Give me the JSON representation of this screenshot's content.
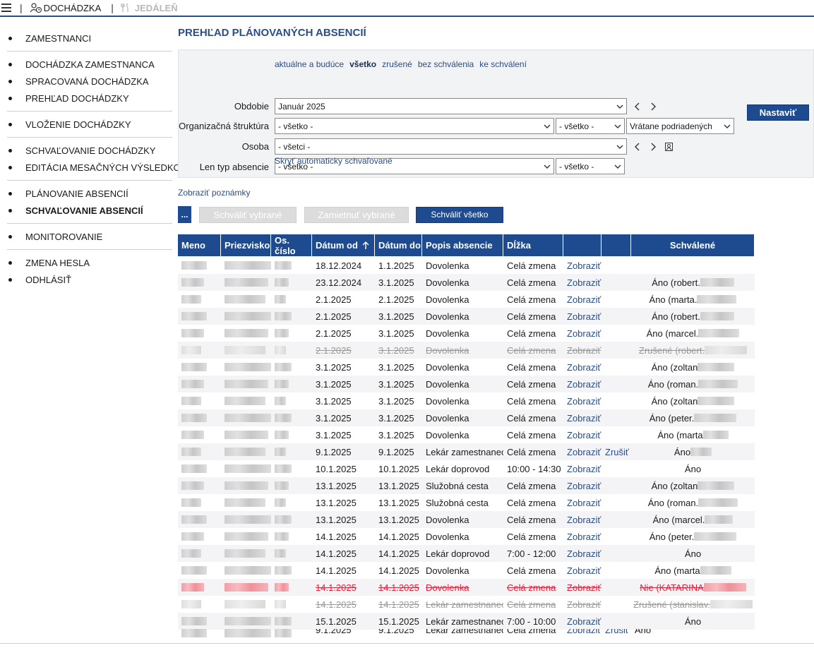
{
  "topbar": {
    "dochadzka": "DOCHÁDZKA",
    "jedalen": "JEDÁLEŇ"
  },
  "sidebar": {
    "groups": [
      [
        "ZAMESTNANCI"
      ],
      [
        "DOCHÁDZKA ZAMESTNANCA",
        "SPRACOVANÁ DOCHÁDZKA",
        "PREHĽAD DOCHÁDZKY"
      ],
      [
        "VLOŽENIE DOCHÁDZKY"
      ],
      [
        "SCHVAĽOVANIE DOCHÁDZKY",
        "EDITÁCIA MESAČNÝCH VÝSLEDKOV"
      ],
      [
        "PLÁNOVANIE ABSENCIÍ",
        "SCHVAĽOVANIE ABSENCIÍ"
      ],
      [
        "MONITOROVANIE"
      ],
      [
        "ZMENA HESLA",
        "ODHLÁSIŤ"
      ]
    ],
    "active": "SCHVAĽOVANIE ABSENCIÍ"
  },
  "page": {
    "title": "PREHĽAD PLÁNOVANÝCH ABSENCIÍ"
  },
  "filters": {
    "quicklinks": [
      "aktuálne a budúce",
      "všetko",
      "zrušené",
      "bez schválenia",
      "ke schválení"
    ],
    "active_quicklink": "všetko",
    "obdobie_label": "Obdobie",
    "obdobie_value": "Január 2025",
    "org_label": "Organizačná štruktúra",
    "org_value": "- všetko -",
    "org_sub_value": "- všetko -",
    "org_incl_value": "Vrátane podriadených",
    "osoba_label": "Osoba",
    "osoba_value": "- všetci -",
    "typ_label": "Len typ absencie",
    "typ_value": "- všetko -",
    "typ_sub_value": "- všetko -",
    "nastavit": "Nastaviť",
    "hide_auto": "Skryť automaticky schvaľované"
  },
  "actions": {
    "show_notes": "Zobraziť poznámky",
    "dots": "...",
    "approve_selected": "Schváliť vybrané",
    "reject_selected": "Zamietnuť vybrané",
    "approve_all": "Schváliť všetko"
  },
  "table": {
    "headers": [
      "Meno",
      "Priezvisko",
      "Os. číslo",
      "Dátum od",
      "Dátum do",
      "Popis absencie",
      "Dĺžka",
      "",
      "",
      "Schválené"
    ],
    "rows": [
      {
        "from": "18.12.2024",
        "to": "1.1.2025",
        "desc": "Dovolenka",
        "len": "Celá zmena",
        "show": "Zobraziť",
        "cancel": "",
        "approved": "",
        "status": "normal"
      },
      {
        "from": "23.12.2024",
        "to": "3.1.2025",
        "desc": "Dovolenka",
        "len": "Celá zmena",
        "show": "Zobraziť",
        "cancel": "",
        "approved": "Áno (robert.",
        "status": "normal"
      },
      {
        "from": "2.1.2025",
        "to": "2.1.2025",
        "desc": "Dovolenka",
        "len": "Celá zmena",
        "show": "Zobraziť",
        "cancel": "",
        "approved": "Áno (marta.",
        "status": "normal"
      },
      {
        "from": "2.1.2025",
        "to": "3.1.2025",
        "desc": "Dovolenka",
        "len": "Celá zmena",
        "show": "Zobraziť",
        "cancel": "",
        "approved": "Áno (robert.",
        "status": "normal"
      },
      {
        "from": "2.1.2025",
        "to": "3.1.2025",
        "desc": "Dovolenka",
        "len": "Celá zmena",
        "show": "Zobraziť",
        "cancel": "",
        "approved": "Áno (marcel.",
        "status": "normal"
      },
      {
        "from": "2.1.2025",
        "to": "3.1.2025",
        "desc": "Dovolenka",
        "len": "Celá zmena",
        "show": "Zobraziť",
        "cancel": "",
        "approved": "Zrušené (robert.",
        "status": "cancelled"
      },
      {
        "from": "3.1.2025",
        "to": "3.1.2025",
        "desc": "Dovolenka",
        "len": "Celá zmena",
        "show": "Zobraziť",
        "cancel": "",
        "approved": "Áno (zoltan",
        "status": "normal"
      },
      {
        "from": "3.1.2025",
        "to": "3.1.2025",
        "desc": "Dovolenka",
        "len": "Celá zmena",
        "show": "Zobraziť",
        "cancel": "",
        "approved": "Áno (roman.",
        "status": "normal"
      },
      {
        "from": "3.1.2025",
        "to": "3.1.2025",
        "desc": "Dovolenka",
        "len": "Celá zmena",
        "show": "Zobraziť",
        "cancel": "",
        "approved": "Áno (zoltan",
        "status": "normal"
      },
      {
        "from": "3.1.2025",
        "to": "3.1.2025",
        "desc": "Dovolenka",
        "len": "Celá zmena",
        "show": "Zobraziť",
        "cancel": "",
        "approved": "Áno (peter.",
        "status": "normal"
      },
      {
        "from": "3.1.2025",
        "to": "3.1.2025",
        "desc": "Dovolenka",
        "len": "Celá zmena",
        "show": "Zobraziť",
        "cancel": "",
        "approved": "Áno (marta",
        "status": "normal"
      },
      {
        "from": "9.1.2025",
        "to": "9.1.2025",
        "desc": "Lekár zamestnanec",
        "len": "Celá zmena",
        "show": "Zobraziť",
        "cancel": "Zrušiť",
        "approved": "Áno",
        "status": "normal"
      },
      {
        "from": "10.1.2025",
        "to": "10.1.2025",
        "desc": "Lekár doprovod",
        "len": "10:00 - 14:30",
        "show": "Zobraziť",
        "cancel": "",
        "approved": "Áno",
        "status": "normal"
      },
      {
        "from": "13.1.2025",
        "to": "13.1.2025",
        "desc": "Služobná cesta",
        "len": "Celá zmena",
        "show": "Zobraziť",
        "cancel": "",
        "approved": "Áno (zoltan",
        "status": "normal"
      },
      {
        "from": "13.1.2025",
        "to": "13.1.2025",
        "desc": "Služobná cesta",
        "len": "Celá zmena",
        "show": "Zobraziť",
        "cancel": "",
        "approved": "Áno (roman.",
        "status": "normal"
      },
      {
        "from": "13.1.2025",
        "to": "13.1.2025",
        "desc": "Dovolenka",
        "len": "Celá zmena",
        "show": "Zobraziť",
        "cancel": "",
        "approved": "Áno (marcel.",
        "status": "normal"
      },
      {
        "from": "14.1.2025",
        "to": "14.1.2025",
        "desc": "Dovolenka",
        "len": "Celá zmena",
        "show": "Zobraziť",
        "cancel": "",
        "approved": "Áno (peter.",
        "status": "normal"
      },
      {
        "from": "14.1.2025",
        "to": "14.1.2025",
        "desc": "Lekár doprovod",
        "len": "7:00 - 12:00",
        "show": "Zobraziť",
        "cancel": "",
        "approved": "Áno",
        "status": "normal"
      },
      {
        "from": "14.1.2025",
        "to": "14.1.2025",
        "desc": "Dovolenka",
        "len": "Celá zmena",
        "show": "Zobraziť",
        "cancel": "",
        "approved": "Áno (marta",
        "status": "normal"
      },
      {
        "from": "14.1.2025",
        "to": "14.1.2025",
        "desc": "Dovolenka",
        "len": "Celá zmena",
        "show": "Zobraziť",
        "cancel": "",
        "approved": "Nie (KATARINA",
        "status": "rejected"
      },
      {
        "from": "14.1.2025",
        "to": "14.1.2025",
        "desc": "Lekár zamestnanec",
        "len": "Celá zmena",
        "show": "Zobraziť",
        "cancel": "",
        "approved": "Zrušené (stanislav.",
        "status": "cancelled"
      },
      {
        "from": "15.1.2025",
        "to": "15.1.2025",
        "desc": "Lekár zamestnanec",
        "len": "7:00 - 10:00",
        "show": "Zobraziť",
        "cancel": "",
        "approved": "Áno",
        "status": "normal"
      }
    ],
    "partial_row": {
      "from": "9.1.2025",
      "to": "9.1.2025",
      "desc": "Lekár zamestnanec",
      "len": "Celá zmena",
      "show": "Zobraziť",
      "cancel": "Zrušiť",
      "approved": "Áno"
    }
  },
  "colors": {
    "primary": "#1e4b8f",
    "link": "#2b4d86",
    "rejected": "#e0233a",
    "cancelled": "#9a9a9a"
  }
}
